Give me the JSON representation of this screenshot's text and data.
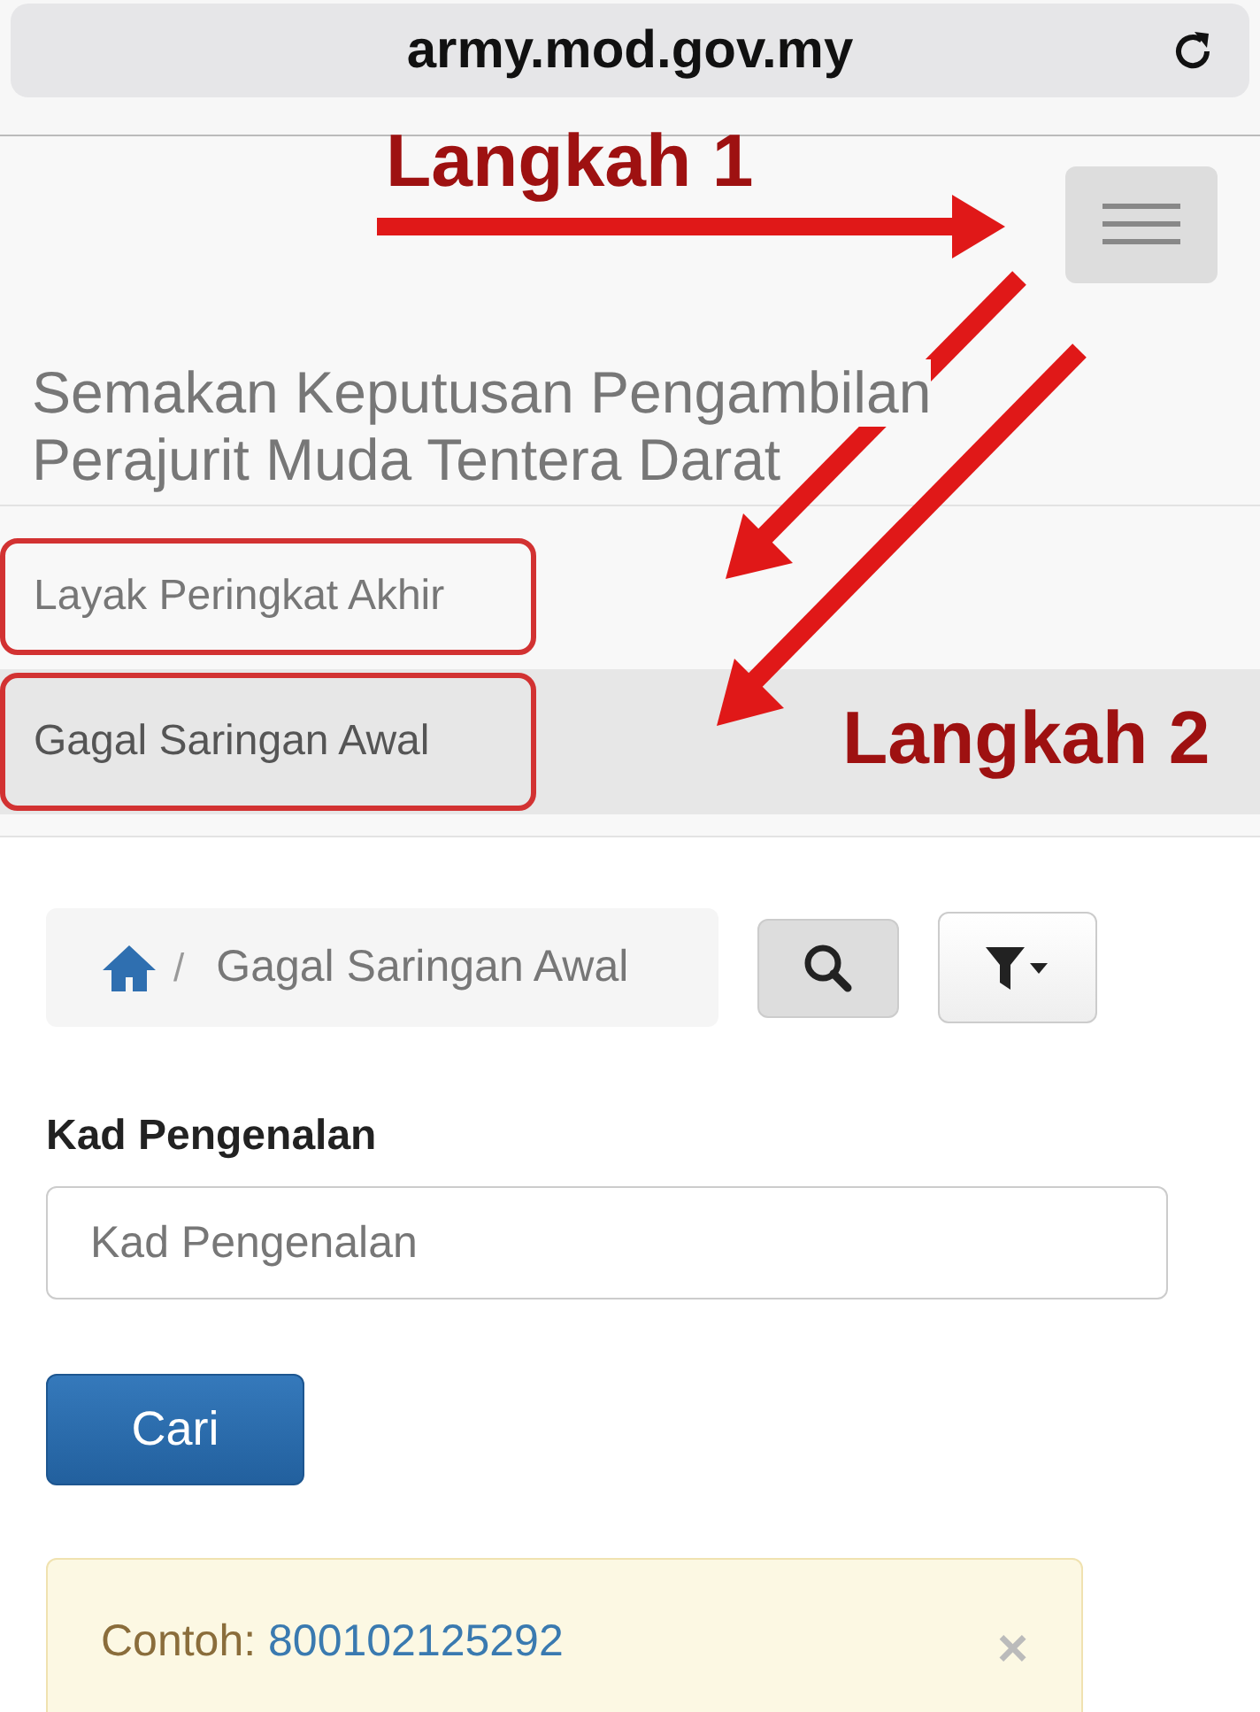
{
  "address_bar": {
    "url": "army.mod.gov.my"
  },
  "navbar": {
    "heading": [
      "Semakan Keputusan Pengambilan",
      "Perajurit Muda Tentera Darat"
    ]
  },
  "menu": [
    {
      "label": "Layak Peringkat Akhir",
      "selected": false,
      "highlighted": true
    },
    {
      "label": "Gagal Saringan Awal",
      "selected": true,
      "highlighted": true
    }
  ],
  "annotations": {
    "step_1": "Langkah 1",
    "step_2": "Langkah 2"
  },
  "breadcrumb": {
    "separator": "/",
    "current": "Gagal Saringan Awal"
  },
  "form": {
    "label": "Kad Pengenalan",
    "placeholder": "Kad Pengenalan",
    "submit": "Cari"
  },
  "alert": {
    "prefix": "Contoh:",
    "example": "800102125292",
    "close": "×"
  }
}
